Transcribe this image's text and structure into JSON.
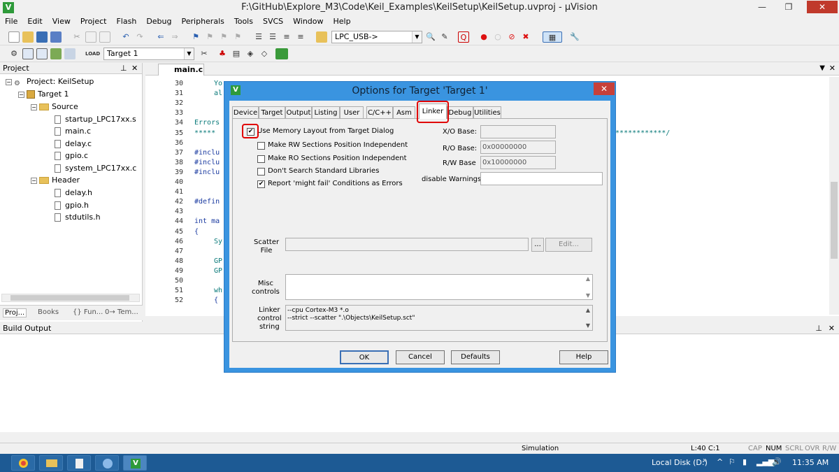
{
  "window": {
    "title": "F:\\GitHub\\Explore_M3\\Code\\Keil_Examples\\KeilSetup\\KeilSetup.uvproj - µVision",
    "min": "—",
    "max": "❐",
    "close": "✕"
  },
  "menu": [
    "File",
    "Edit",
    "View",
    "Project",
    "Flash",
    "Debug",
    "Peripherals",
    "Tools",
    "SVCS",
    "Window",
    "Help"
  ],
  "toolbar": {
    "target_combo": "LPC_USB->",
    "target_select": "Target 1"
  },
  "project_panel": {
    "title": "Project",
    "root": "Project: KeilSetup",
    "target": "Target 1",
    "groups": [
      {
        "name": "Source",
        "files": [
          "startup_LPC17xx.s",
          "main.c",
          "delay.c",
          "gpio.c",
          "system_LPC17xx.c"
        ]
      },
      {
        "name": "Header",
        "files": [
          "delay.h",
          "gpio.h",
          "stdutils.h"
        ]
      }
    ],
    "bottom_tabs": [
      "Proj...",
      "Books",
      "{} Fun...",
      "0→ Tem..."
    ]
  },
  "editor": {
    "tab": "main.c",
    "line_numbers": [
      "30",
      "31",
      "32",
      "33",
      "34",
      "35",
      "36",
      "37",
      "38",
      "39",
      "40",
      "41",
      "42",
      "43",
      "44",
      "45",
      "46",
      "47",
      "48",
      "49",
      "50",
      "51",
      "52"
    ],
    "fragments": [
      {
        "line": 0,
        "text": "Yo"
      },
      {
        "line": 1,
        "text": "al"
      },
      {
        "line": 4,
        "text": "Errors"
      },
      {
        "line": 5,
        "text": "*****"
      },
      {
        "line": 7,
        "text": "#inclu"
      },
      {
        "line": 8,
        "text": "#inclu"
      },
      {
        "line": 9,
        "text": "#inclu"
      },
      {
        "line": 12,
        "text": "#defin"
      },
      {
        "line": 14,
        "text": "int ma"
      },
      {
        "line": 15,
        "text": "{"
      },
      {
        "line": 16,
        "text": "Sy"
      },
      {
        "line": 18,
        "text": "GP"
      },
      {
        "line": 19,
        "text": "GP"
      },
      {
        "line": 21,
        "text": "wh"
      },
      {
        "line": 22,
        "text": "{"
      }
    ],
    "right_stars": "**************/"
  },
  "output": {
    "title": "Build Output"
  },
  "status": {
    "mode": "Simulation",
    "position": "L:40 C:1",
    "caps": "CAP",
    "num": "NUM",
    "scrl": "SCRL",
    "ovr": "OVR",
    "rw": "R/W"
  },
  "taskbar": {
    "drive": "Local Disk (D:)",
    "time": "11:35 AM"
  },
  "dialog": {
    "title": "Options for Target 'Target 1'",
    "tabs": [
      "Device",
      "Target",
      "Output",
      "Listing",
      "User",
      "C/C++",
      "Asm",
      "Linker",
      "Debug",
      "Utilities"
    ],
    "active_tab": "Linker",
    "checkboxes": [
      {
        "label": "Use Memory Layout from Target Dialog",
        "checked": true
      },
      {
        "label": "Make RW Sections Position Independent",
        "checked": false
      },
      {
        "label": "Make RO Sections Position Independent",
        "checked": false
      },
      {
        "label": "Don't Search Standard Libraries",
        "checked": false
      },
      {
        "label": "Report 'might fail' Conditions as Errors",
        "checked": true
      }
    ],
    "xo_base_label": "X/O Base:",
    "xo_base": "",
    "ro_base_label": "R/O Base:",
    "ro_base": "0x00000000",
    "rw_base_label": "R/W Base",
    "rw_base": "0x10000000",
    "warnings_label": "disable Warnings:",
    "warnings": "",
    "scatter_label": "Scatter\nFile",
    "scatter_browse": "...",
    "scatter_edit": "Edit...",
    "misc_label": "Misc\ncontrols",
    "linker_label": "Linker\ncontrol\nstring",
    "linker_lines": [
      "--cpu Cortex-M3 *.o",
      "--strict --scatter \".\\Objects\\KeilSetup.sct\""
    ],
    "buttons": {
      "ok": "OK",
      "cancel": "Cancel",
      "defaults": "Defaults",
      "help": "Help"
    }
  },
  "colors": {
    "taskbar": "#1d5a94",
    "dialog_frame": "#3a94e0",
    "highlight": "#e00000"
  }
}
